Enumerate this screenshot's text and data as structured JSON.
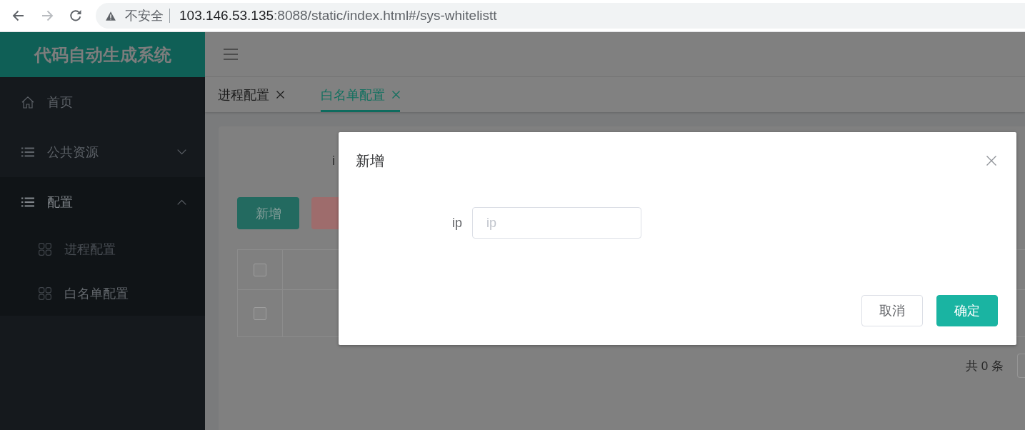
{
  "browser": {
    "nav_buttons": [
      {
        "kind": "back",
        "disabled": false
      },
      {
        "kind": "forward",
        "disabled": true
      },
      {
        "kind": "reload",
        "disabled": false
      }
    ],
    "address_bar": {
      "security_label": "不安全",
      "host": "103.146.53.135",
      "path": ":8088/static/index.html#/sys-whitelistt"
    }
  },
  "sidebar": {
    "title": "代码自动生成系统",
    "items": [
      {
        "label": "首页",
        "kind": "link"
      },
      {
        "label": "公共资源",
        "kind": "group",
        "expanded": false
      },
      {
        "label": "配置",
        "kind": "group",
        "expanded": true,
        "children": [
          {
            "label": "进程配置",
            "selected": false
          },
          {
            "label": "白名单配置",
            "selected": true
          }
        ]
      }
    ]
  },
  "tabs": [
    {
      "label": "进程配置",
      "selected": false
    },
    {
      "label": "白名单配置",
      "selected": true
    }
  ],
  "search_form": {
    "label": "i"
  },
  "toolbar": [
    {
      "label": "新增",
      "kind": "primary"
    },
    {
      "kind": "danger"
    }
  ],
  "table": {
    "header_checked": false,
    "rows": [
      {
        "checked": false
      }
    ]
  },
  "pagination": {
    "total": "共 0 条"
  },
  "dialog": {
    "title": "新增",
    "fields": [
      {
        "label": "ip",
        "placeholder": "ip"
      }
    ],
    "buttons": [
      {
        "label": "取消",
        "kind": "default"
      },
      {
        "label": "确定",
        "kind": "primary"
      }
    ]
  }
}
